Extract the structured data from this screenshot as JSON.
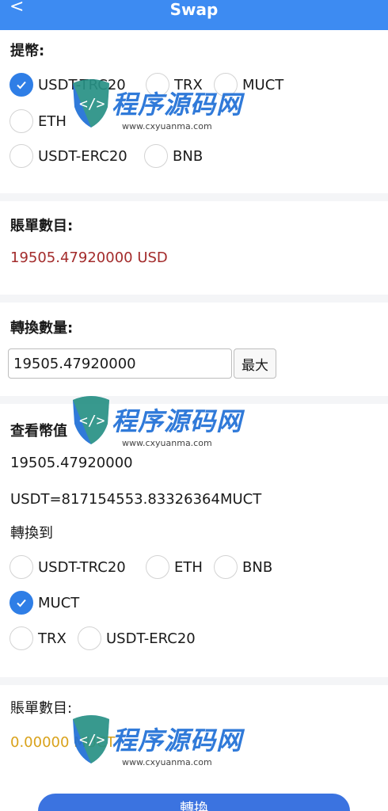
{
  "header": {
    "title": "Swap",
    "back_glyph": "<"
  },
  "withdraw": {
    "label": "提幣:",
    "options": [
      {
        "label": "USDT-TRC20",
        "checked": true
      },
      {
        "label": "TRX",
        "checked": false
      },
      {
        "label": "MUCT",
        "checked": false
      },
      {
        "label": "ETH",
        "checked": false
      },
      {
        "label": "USDT-ERC20",
        "checked": false
      },
      {
        "label": "BNB",
        "checked": false
      }
    ]
  },
  "balance": {
    "label": "賬單數目:",
    "value": "19505.47920000 USD"
  },
  "convert_amount": {
    "label": "轉換數量:",
    "input_value": "19505.47920000",
    "max_label": "最大"
  },
  "rate": {
    "label": "查看幣值",
    "amount": "19505.47920000",
    "conversion": "USDT=817154553.83326364MUCT"
  },
  "convert_to": {
    "label": "轉換到",
    "options": [
      {
        "label": "USDT-TRC20",
        "checked": false
      },
      {
        "label": "ETH",
        "checked": false
      },
      {
        "label": "BNB",
        "checked": false
      },
      {
        "label": "MUCT",
        "checked": true
      },
      {
        "label": "TRX",
        "checked": false
      },
      {
        "label": "USDT-ERC20",
        "checked": false
      }
    ]
  },
  "result": {
    "label": "賬單數目:",
    "value": "0.00000",
    "value_suffix": "MUCT"
  },
  "submit": {
    "label": "轉換"
  },
  "watermark": {
    "text": "程序源码网",
    "url": "www.cxyuanma.com"
  },
  "colors": {
    "accent": "#3d8bf2",
    "check": "#2f7ee6",
    "balance": "#a32b2b",
    "result": "#d9a21b"
  }
}
